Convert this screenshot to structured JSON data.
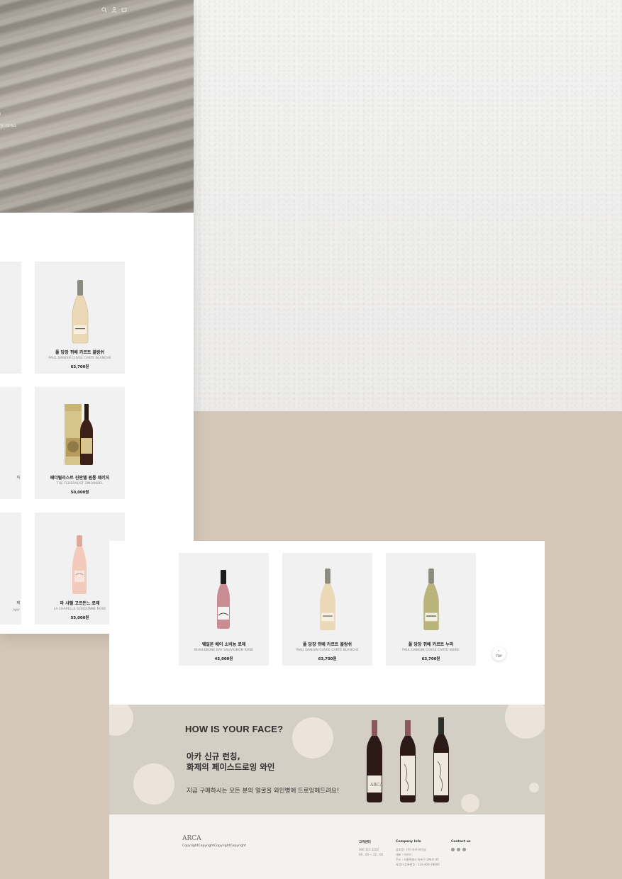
{
  "mockup_left": {
    "hero": {
      "top_icons": [
        "search-icon",
        "user-icon",
        "cart-icon"
      ],
      "fragment_line1": "I",
      "fragment_line2": "헌나보세요"
    },
    "products": [
      {
        "name": "폴 당장 뀌베 카르트 블랑쉬",
        "en": "PAUL DANGIN CUVEE CARTE BLANCHE",
        "price": "63,700원"
      },
      {
        "name": "페더럴리스트 진판델 원통 패키지",
        "en": "THE FEDERALIST ZINFANDEL",
        "price": "50,000원"
      },
      {
        "name": "라 샤펠 고르돈느 로제",
        "en": "LA CHAPELLE GORDONNE ROSE",
        "price": "55,000원"
      }
    ],
    "partial_fragments": [
      "지",
      "제",
      "NAY"
    ]
  },
  "mockup_right": {
    "products": [
      {
        "name": "웨일본 베이 소비뇽 로제",
        "en": "WHALEBONE BAY SAUVIGNON ROSE",
        "price": "45,000원"
      },
      {
        "name": "폴 당장 뀌베 카르트 블랑쉬",
        "en": "PAUL DANGIN CUVEE CARTE BLANCHE",
        "price": "63,700원"
      },
      {
        "name": "폴 당장 뀌베 카르트 누와",
        "en": "PAUL DANGIN CUVEE CARTE NOIRE",
        "price": "63,700원"
      }
    ],
    "top_button": {
      "arrow": "⌃",
      "label": "TOP"
    },
    "banner": {
      "title": "HOW IS YOUR FACE?",
      "subtitle_line1": "아카 신규 런칭,",
      "subtitle_line2": "화제의 페이스드로잉 와인",
      "description": "지금 구매하시는 모든 분의 얼굴을 와인병에 드로잉해드려요!"
    },
    "footer": {
      "logo": "ARCA",
      "copyright": "CopyrightCopyrightCopyrightCopyright",
      "col1": {
        "heading": "고객센터",
        "lines": [
          "000 111 2222",
          "09 : 00 ~ 22 : 00"
        ]
      },
      "col2": {
        "heading": "Company Info",
        "lines": [
          "상호명 : (주) 아카 와인샵",
          "대표 : 아카다",
          "주소 : 서울특별시 마포구 양화로 45",
          "사업자 등록번호 : 123-456-78000"
        ]
      },
      "col3": {
        "heading": "Contact us"
      }
    }
  },
  "colors": {
    "paper": "#efeeed",
    "beige": "#d5c7b7",
    "card": "#f1f1f1",
    "banner": "#d4cfc5",
    "circle": "#ece4db"
  }
}
